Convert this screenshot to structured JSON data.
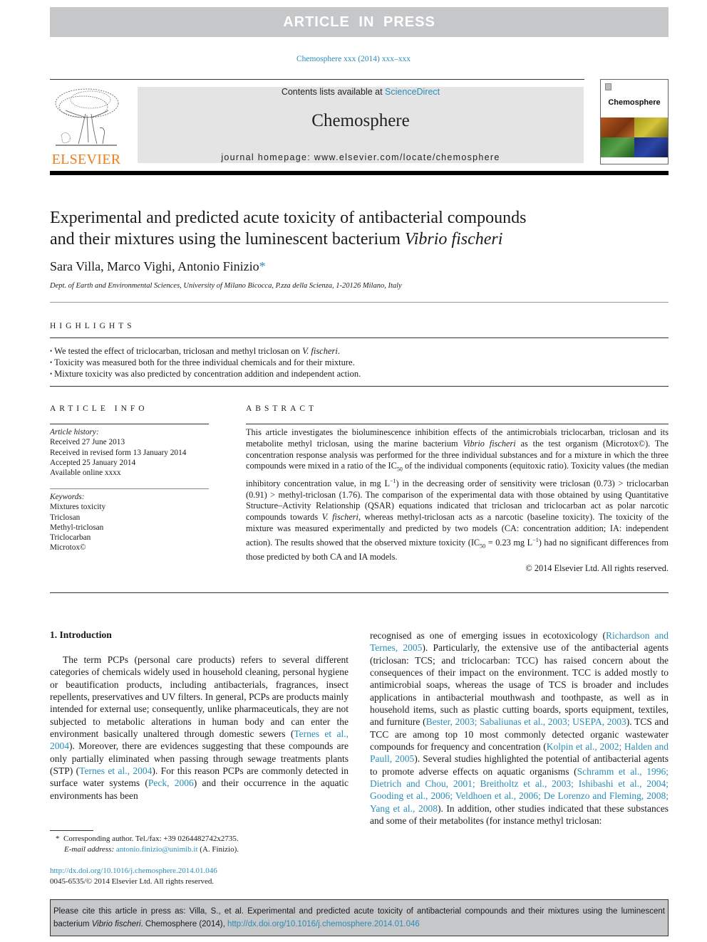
{
  "banner": {
    "label": "ARTICLE IN PRESS"
  },
  "journal_ref": "Chemosphere xxx (2014) xxx–xxx",
  "masthead": {
    "contents_prefix": "Contents lists available at ",
    "contents_link": "ScienceDirect",
    "journal_title": "Chemosphere",
    "homepage": "journal homepage: www.elsevier.com/locate/chemosphere",
    "publisher_logo_text": "ELSEVIER",
    "cover_title": "Chemosphere"
  },
  "article": {
    "title_line1": "Experimental and predicted acute toxicity of antibacterial compounds",
    "title_line2": "and their mixtures using the luminescent bacterium ",
    "title_species": "Vibrio fischeri",
    "authors": "Sara Villa, Marco Vighi, Antonio Finizio",
    "author_marker": "*",
    "affiliation": "Dept. of Earth and Environmental Sciences, University of Milano Bicocca, P.zza della Scienza, 1-20126 Milano, Italy"
  },
  "highlights": {
    "heading": "HIGHLIGHTS",
    "items": [
      {
        "text": "We tested the effect of triclocarban, triclosan and methyl triclosan on ",
        "italic": "V. fischeri",
        "tail": "."
      },
      {
        "text": "Toxicity was measured both for the three individual chemicals and for their mixture.",
        "italic": "",
        "tail": ""
      },
      {
        "text": "Mixture toxicity was also predicted by concentration addition and independent action.",
        "italic": "",
        "tail": ""
      }
    ]
  },
  "article_info": {
    "heading": "ARTICLE INFO",
    "history_label": "Article history:",
    "history": [
      "Received 27 June 2013",
      "Received in revised form 13 January 2014",
      "Accepted 25 January 2014",
      "Available online xxxx"
    ],
    "keywords_label": "Keywords:",
    "keywords": [
      "Mixtures toxicity",
      "Triclosan",
      "Methyl-triclosan",
      "Triclocarban",
      "Microtox©"
    ]
  },
  "abstract": {
    "heading": "ABSTRACT",
    "p1": "This article investigates the bioluminescence inhibition effects of the antimicrobials triclocarban, triclosan and its metabolite methyl triclosan, using the marine bacterium ",
    "species": "Vibrio fischeri",
    "p2": " as the test organism (Microtox©). The concentration response analysis was performed for the three individual substances and for a mixture in which the three compounds were mixed in a ratio of the IC",
    "sub50": "50",
    "p3": " of the individual components (equitoxic ratio). Toxicity values (the median inhibitory concentration value, in mg L",
    "sup_neg1": "−1",
    "p4": ") in the decreasing order of sensitivity were triclosan (0.73) > triclocarban (0.91) > methyl-triclosan (1.76). The comparison of the experimental data with those obtained by using Quantitative Structure–Activity Relationship (QSAR) equations indicated that triclosan and triclocarban act as polar narcotic compounds towards ",
    "species_short": "V. fischeri",
    "p5": ", whereas methyl-triclosan acts as a narcotic (baseline toxicity). The toxicity of the mixture was measured experimentally and predicted by two models (CA: concentration addition; IA: independent action). The results showed that the observed mixture toxicity (IC",
    "p6": " = 0.23 mg L",
    "p7": ") had no significant differences from those predicted by both CA and IA models.",
    "copyright": "© 2014 Elsevier Ltd. All rights reserved."
  },
  "intro": {
    "heading": "1. Introduction",
    "left": {
      "a": "The term PCPs (personal care products) refers to several different categories of chemicals widely used in household cleaning, personal hygiene or beautification products, including antibacterials, fragrances, insect repellents, preservatives and UV filters. In general, PCPs are products mainly intended for external use; consequently, unlike pharmaceuticals, they are not subjected to metabolic alterations in human body and can enter the environment basically unaltered through domestic sewers (",
      "ref1": "Ternes et al., 2004",
      "b": "). Moreover, there are evidences suggesting that these compounds are only partially eliminated when passing through sewage treatments plants (STP) (",
      "ref2": "Ternes et al., 2004",
      "c": "). For this reason PCPs are commonly detected in surface water systems (",
      "ref3": "Peck, 2006",
      "d": ") and their occurrence in the aquatic environments has been"
    },
    "right": {
      "a": "recognised as one of emerging issues in ecotoxicology (",
      "ref1": "Richardson and Ternes, 2005",
      "b": "). Particularly, the extensive use of the antibacterial agents (triclosan: TCS; and triclocarban: TCC) has raised concern about the consequences of their impact on the environment. TCC is added mostly to antimicrobial soaps, whereas the usage of TCS is broader and includes applications in antibacterial mouthwash and toothpaste, as well as in household items, such as plastic cutting boards, sports equipment, textiles, and furniture (",
      "ref2": "Bester, 2003; Sabaliunas et al., 2003; USEPA, 2003",
      "c": "). TCS and TCC are among top 10 most commonly detected organic wastewater compounds for frequency and concentration (",
      "ref3": "Kolpin et al., 2002; Halden and Paull, 2005",
      "d": "). Several studies highlighted the potential of antibacterial agents to promote adverse effects on aquatic organisms (",
      "ref4": "Schramm et al., 1996; Dietrich and Chou, 2001; Breitholtz et al., 2003; Ishibashi et al., 2004; Gooding et al., 2006; Veldhoen et al., 2006; De Lorenzo and Fleming, 2008; Yang et al., 2008",
      "e": "). In addition, other studies indicated that these substances and some of their metabolites (for instance methyl triclosan:"
    }
  },
  "footnotes": {
    "corresponding": "Corresponding author. Tel./fax: +39 0264482742x2735.",
    "email_label": "E-mail address: ",
    "email": "antonio.finizio@unimib.it",
    "email_tail": " (A. Finizio).",
    "doi": "http://dx.doi.org/10.1016/j.chemosphere.2014.01.046",
    "issn": "0045-6535/© 2014 Elsevier Ltd. All rights reserved."
  },
  "citation": {
    "prefix": "Please cite this article in press as: Villa, S., et al. Experimental and predicted acute toxicity of antibacterial compounds and their mixtures using the luminescent bacterium ",
    "species": "Vibrio fischeri",
    "mid": ". Chemosphere (2014), ",
    "link": "http://dx.doi.org/10.1016/j.chemosphere.2014.01.046"
  }
}
